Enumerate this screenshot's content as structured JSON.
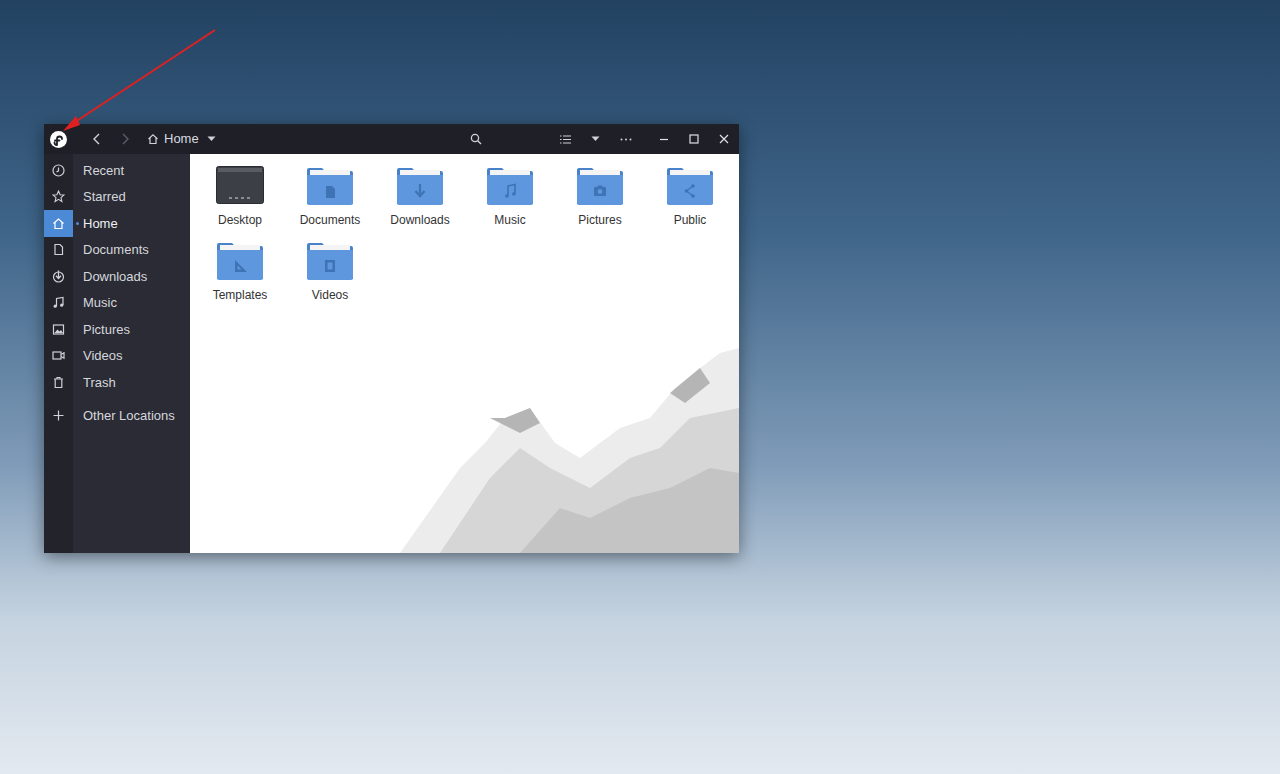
{
  "window": {
    "title": "Home"
  },
  "navigation": {
    "back_enabled": true,
    "forward_enabled": false
  },
  "sidebar": {
    "items": [
      {
        "label": "Recent",
        "selected": false
      },
      {
        "label": "Starred",
        "selected": false
      },
      {
        "label": "Home",
        "selected": true
      },
      {
        "label": "Documents",
        "selected": false
      },
      {
        "label": "Downloads",
        "selected": false
      },
      {
        "label": "Music",
        "selected": false
      },
      {
        "label": "Pictures",
        "selected": false
      },
      {
        "label": "Videos",
        "selected": false
      },
      {
        "label": "Trash",
        "selected": false
      }
    ],
    "other_locations": "Other Locations"
  },
  "files": [
    {
      "name": "Desktop"
    },
    {
      "name": "Documents"
    },
    {
      "name": "Downloads"
    },
    {
      "name": "Music"
    },
    {
      "name": "Pictures"
    },
    {
      "name": "Public"
    },
    {
      "name": "Templates"
    },
    {
      "name": "Videos"
    }
  ]
}
